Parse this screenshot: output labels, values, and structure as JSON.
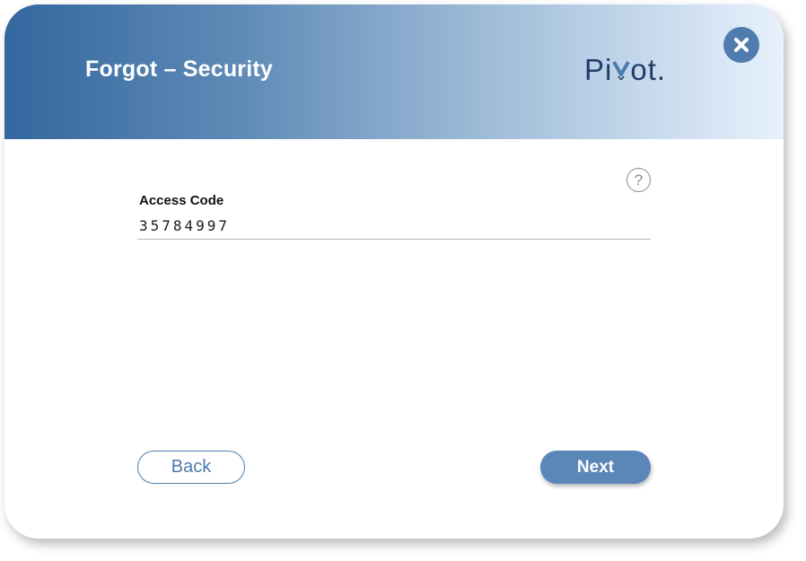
{
  "dialog": {
    "title": "Forgot – Security",
    "logo": {
      "prefix": "Pi",
      "suffix": "ot.",
      "mark_icon": "pivot-v-mark-icon",
      "mark_color": "#4f7cae"
    },
    "close_icon": "close-icon",
    "help_icon": "help-question-icon",
    "help_glyph": "?"
  },
  "form": {
    "access_code_label": "Access Code",
    "access_code_value": "35784997"
  },
  "actions": {
    "back_label": "Back",
    "next_label": "Next"
  },
  "colors": {
    "header_gradient_start": "#33679e",
    "header_gradient_end": "#e7f1fc",
    "accent": "#4f7cae",
    "logo_text": "#1f3d6b"
  }
}
